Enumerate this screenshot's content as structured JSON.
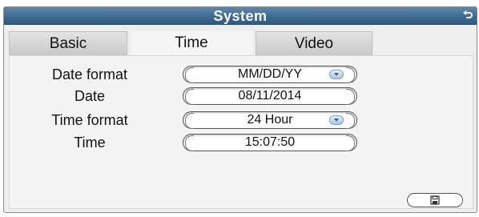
{
  "window": {
    "title": "System"
  },
  "tabs": [
    {
      "label": "Basic",
      "active": false
    },
    {
      "label": "Time",
      "active": true
    },
    {
      "label": "Video",
      "active": false
    }
  ],
  "settings": {
    "date_format": {
      "label": "Date format",
      "value": "MM/DD/YY"
    },
    "date": {
      "label": "Date",
      "value": "08/11/2014"
    },
    "time_format": {
      "label": "Time format",
      "value": "24 Hour"
    },
    "time": {
      "label": "Time",
      "value": "15:07:50"
    }
  },
  "icons": {
    "back": "return-arrow-icon",
    "save": "floppy-disk-icon",
    "dropdown": "chevron-down-icon"
  },
  "colors": {
    "titlebar": "#3f6b93",
    "title_text": "#ffffff",
    "panel": "#f4f4f4",
    "tab_inactive": "#d0d0d0"
  }
}
